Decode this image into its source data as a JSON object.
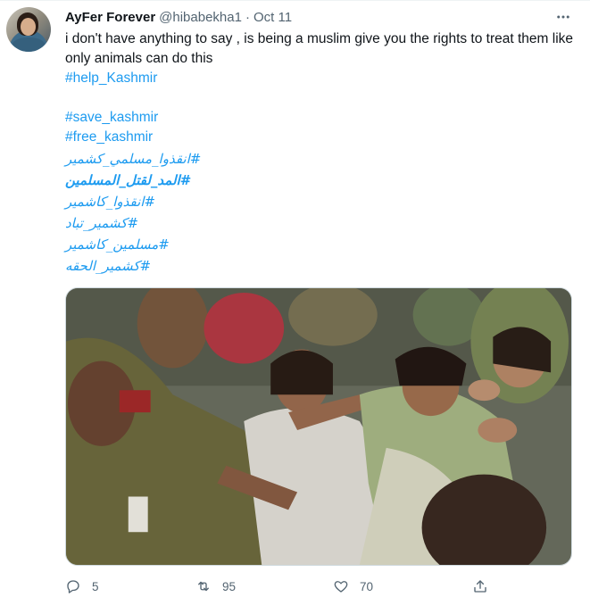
{
  "tweet": {
    "author_name": "AyFer Forever",
    "author_handle": "@hibabekha1",
    "separator": "·",
    "date": "Oct 11",
    "text": "i don't have anything to say , is being a muslim give you the rights to treat them like  only animals can do this",
    "hashtags": [
      "#help_Kashmir",
      "#save_kashmir",
      "#free_kashmir"
    ],
    "urdu_hashtags": [
      "#انقذوا_مسلمي_كشمير",
      "#المد_لقتل_المسلمين",
      "#انقذوا_كاشمير",
      "#كشمير_تباد",
      "#مسلمين_كاشمير",
      "#كشمير_الحقه"
    ],
    "image_alt": "Police officers grappling with protesting women"
  },
  "actions": {
    "reply_count": "5",
    "retweet_count": "95",
    "like_count": "70"
  },
  "icons": {
    "more": "more-horizontal-icon",
    "reply": "reply-icon",
    "retweet": "retweet-icon",
    "like": "heart-icon",
    "share": "share-icon"
  },
  "colors": {
    "link": "#1d9bf0",
    "secondary_text": "#536471",
    "primary_text": "#0f1419"
  }
}
